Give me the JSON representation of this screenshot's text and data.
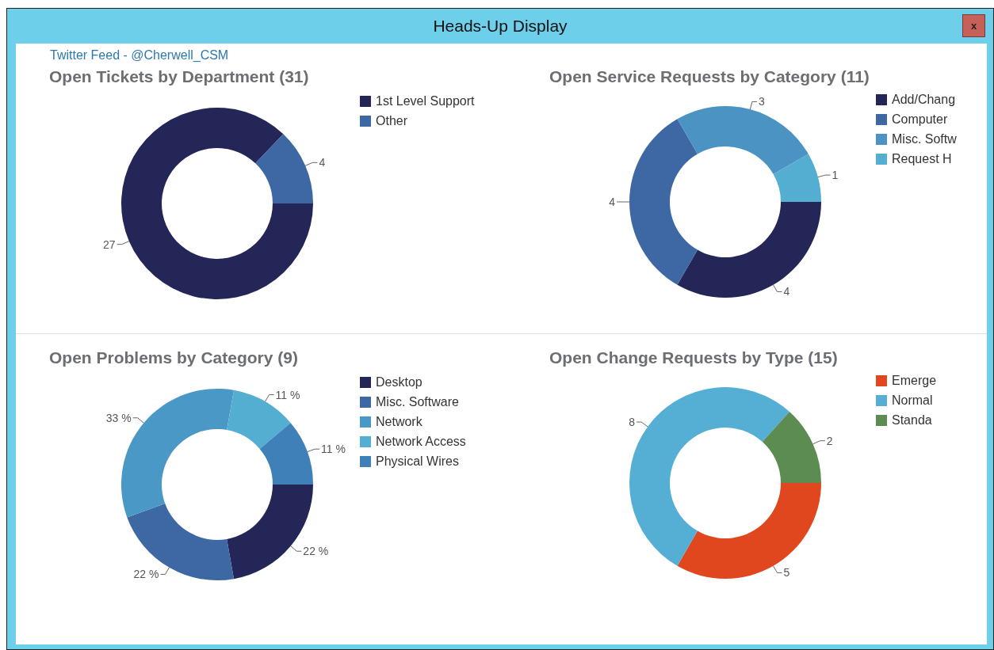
{
  "window": {
    "title": "Heads-Up Display",
    "close_label": "x"
  },
  "feed_link": "Twitter Feed - @Cherwell_CSM",
  "charts": [
    {
      "slices": [
        {
          "color": "#232656"
        },
        {
          "color": "#3d68a4"
        }
      ],
      "chart_data": {
        "type": "donut",
        "title": "Open Tickets by Department (31)",
        "categories": [
          "1st Level Support",
          "Other"
        ],
        "series": [
          {
            "values": [
              27,
              4
            ]
          }
        ],
        "data_labels": true
      }
    },
    {
      "slices": [
        {
          "color": "#232656"
        },
        {
          "color": "#3d68a4"
        },
        {
          "color": "#4a93c2"
        },
        {
          "color": "#53aed2"
        }
      ],
      "chart_data": {
        "type": "donut",
        "title": "Open Service Requests by Category (11)",
        "categories": [
          "Add/Chang",
          "Computer",
          "Misc. Softw",
          "Request H"
        ],
        "series": [
          {
            "values": [
              4,
              4,
              3,
              1
            ]
          }
        ],
        "data_labels": true
      }
    },
    {
      "slices": [
        {
          "color": "#232656"
        },
        {
          "color": "#3d68a4"
        },
        {
          "color": "#4a98c5"
        },
        {
          "color": "#53aed2"
        },
        {
          "color": "#3f80b8"
        }
      ],
      "chart_data": {
        "type": "donut",
        "title": "Open Problems by Category (9)",
        "categories": [
          "Desktop",
          "Misc. Software",
          "Network",
          "Network Access",
          "Physical Wires"
        ],
        "series": [
          {
            "values": [
              22,
              22,
              33,
              11,
              11
            ]
          }
        ],
        "value_labels": [
          "22 %",
          "22 %",
          "33 %",
          "11 %",
          "11 %"
        ]
      }
    },
    {
      "slices": [
        {
          "color": "#e0471f"
        },
        {
          "color": "#55afd5"
        },
        {
          "color": "#5c8c52"
        }
      ],
      "chart_data": {
        "type": "donut",
        "title": "Open Change Requests by Type (15)",
        "categories": [
          "Emerge",
          "Normal",
          "Standa"
        ],
        "series": [
          {
            "values": [
              5,
              8,
              2
            ]
          }
        ],
        "data_labels": true
      }
    }
  ]
}
